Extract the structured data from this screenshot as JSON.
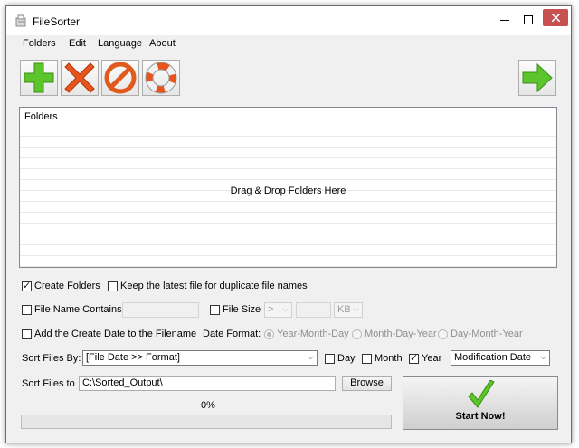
{
  "window": {
    "title": "FileSorter"
  },
  "menu": {
    "items": [
      "Folders",
      "Edit",
      "Language",
      "About"
    ]
  },
  "toolbar": {
    "add_icon": "green-plus-icon",
    "remove_icon": "red-x-icon",
    "clear_icon": "no-entry-icon",
    "help_icon": "lifebuoy-icon",
    "next_icon": "green-right-arrow-icon"
  },
  "folders": {
    "header": "Folders",
    "drop_hint": "Drag & Drop Folders Here"
  },
  "options": {
    "create_folders": {
      "label": "Create Folders",
      "checked": true
    },
    "keep_latest": {
      "label": "Keep the latest file for duplicate file names",
      "checked": false
    },
    "file_name_contains": {
      "label": "File Name Contains",
      "checked": false,
      "value": ""
    },
    "file_size": {
      "label": "File Size",
      "checked": false,
      "operator": ">",
      "value": "",
      "unit": "KB"
    },
    "add_create_date": {
      "label": "Add the Create Date to the Filename",
      "checked": false
    },
    "date_format": {
      "label": "Date Format:",
      "options": [
        "Year-Month-Day",
        "Month-Day-Year",
        "Day-Month-Year"
      ],
      "selected": "Year-Month-Day"
    },
    "sort_by": {
      "label": "Sort Files By:",
      "value": "[File Date >> Format]",
      "day": {
        "label": "Day",
        "checked": false
      },
      "month": {
        "label": "Month",
        "checked": false
      },
      "year": {
        "label": "Year",
        "checked": true
      },
      "date_type": "Modification Date"
    },
    "sort_to": {
      "label": "Sort Files to",
      "value": "C:\\Sorted_Output\\",
      "browse_label": "Browse"
    }
  },
  "progress": {
    "text": "0%",
    "value": 0
  },
  "start": {
    "label": "Start Now!"
  },
  "colors": {
    "accent_green": "#55c62a",
    "close_red": "#c75050",
    "window_bg": "#f0f0f0"
  }
}
